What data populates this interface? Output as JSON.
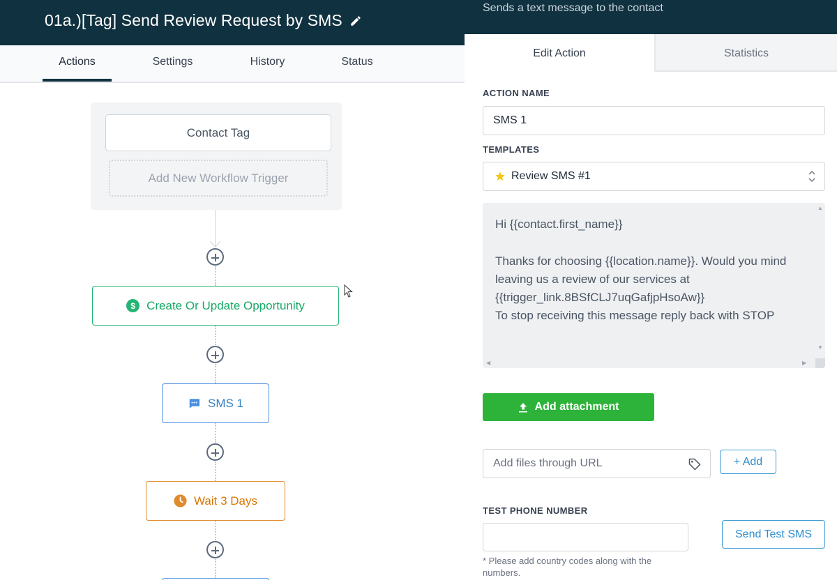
{
  "header": {
    "title": "01a.)[Tag] Send Review Request by SMS",
    "tabs": [
      {
        "label": "Actions",
        "active": true
      },
      {
        "label": "Settings"
      },
      {
        "label": "History"
      },
      {
        "label": "Status"
      }
    ]
  },
  "workflow": {
    "trigger": "Contact Tag",
    "add_trigger": "Add New Workflow Trigger",
    "actions": [
      {
        "label": "Create Or Update Opportunity",
        "icon": "dollar-icon",
        "color": "#16a765"
      },
      {
        "label": "SMS 1",
        "icon": "chat-icon",
        "color": "#3b82c4"
      },
      {
        "label": "Wait 3 Days",
        "icon": "clock-icon",
        "color": "#d97706"
      }
    ]
  },
  "panel": {
    "subtitle": "Sends a text message to the contact",
    "tabs": [
      {
        "label": "Edit Action",
        "active": true
      },
      {
        "label": "Statistics"
      }
    ],
    "action_name_label": "ACTION NAME",
    "action_name_value": "SMS 1",
    "templates_label": "TEMPLATES",
    "template_selected": "Review SMS #1",
    "message": "Hi {{contact.first_name}}\n\nThanks for choosing {{location.name}}. Would you mind leaving us a review of our services at {{trigger_link.8BSfCLJ7uqGafjpHsoAw}}\nTo stop receiving this message reply back with STOP",
    "add_attachment": "Add attachment",
    "url_placeholder": "Add files through URL",
    "add_button": "+ Add",
    "test_phone_label": "TEST PHONE NUMBER",
    "test_phone_value": "",
    "send_test": "Send Test SMS",
    "hint": "Please add country codes along with the numbers."
  }
}
